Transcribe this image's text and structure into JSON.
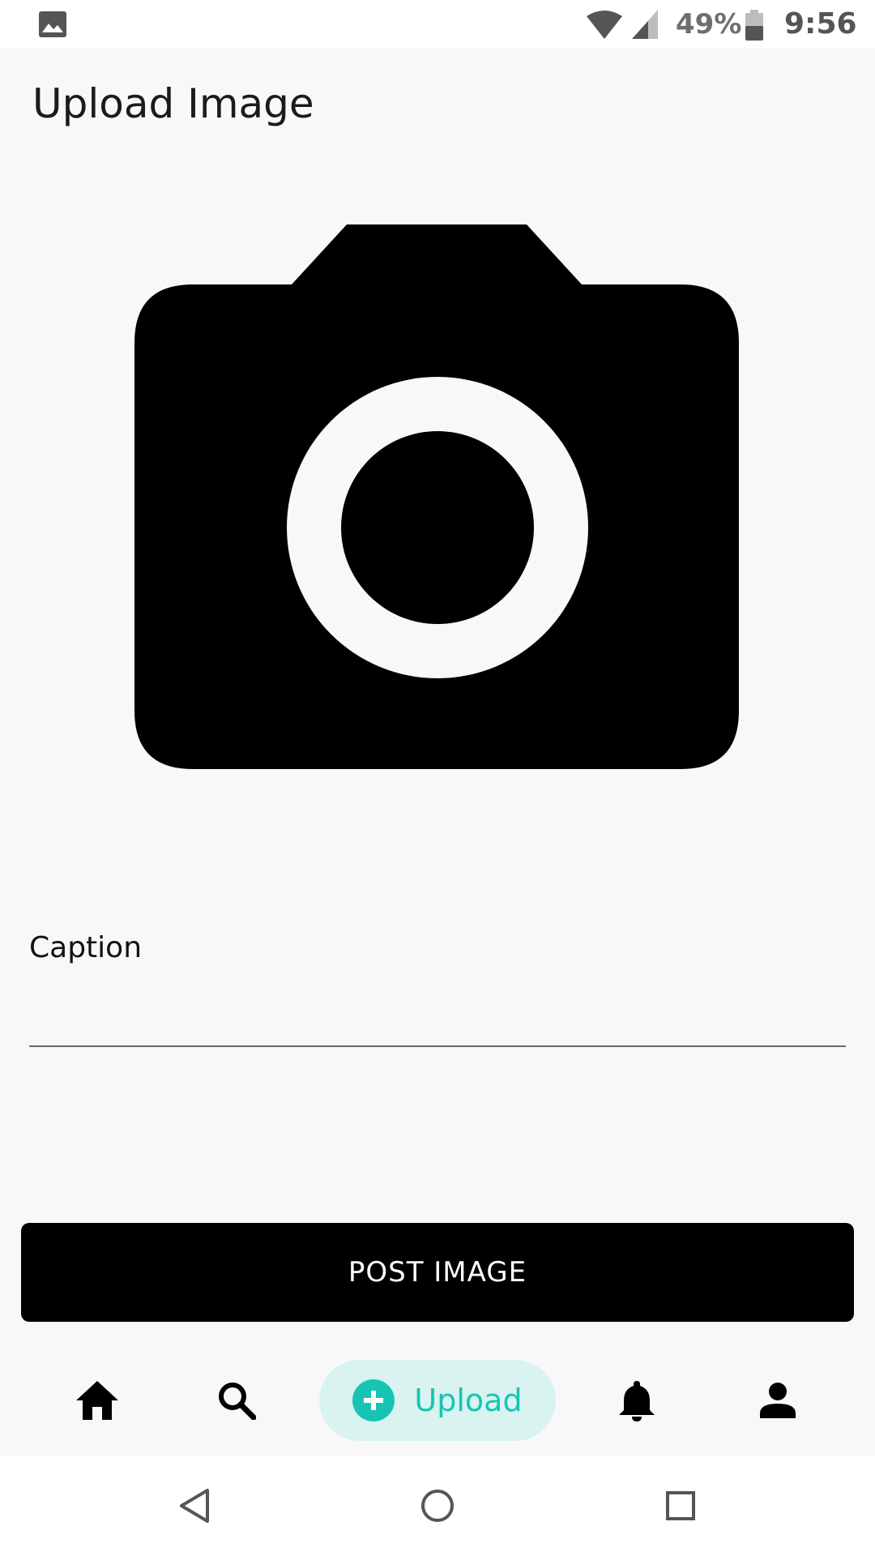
{
  "status_bar": {
    "battery_percent": "49%",
    "time": "9:56",
    "icons": [
      "gallery-icon",
      "wifi-icon",
      "signal-icon",
      "battery-icon"
    ]
  },
  "page": {
    "title": "Upload Image"
  },
  "image_picker": {
    "icon": "camera-icon"
  },
  "caption": {
    "label": "Caption",
    "value": "",
    "placeholder": ""
  },
  "post_button": {
    "label": "POST IMAGE"
  },
  "bottom_nav": {
    "items": [
      {
        "icon": "home-icon"
      },
      {
        "icon": "search-icon"
      },
      {
        "icon": "plus-icon",
        "label": "Upload",
        "active": true
      },
      {
        "icon": "bell-icon"
      },
      {
        "icon": "person-icon"
      }
    ],
    "accent_color": "#17c4b4",
    "active_bg_color": "#d8f3f0"
  },
  "system_nav": {
    "buttons": [
      "back-icon",
      "home-circle-icon",
      "recents-icon"
    ]
  }
}
